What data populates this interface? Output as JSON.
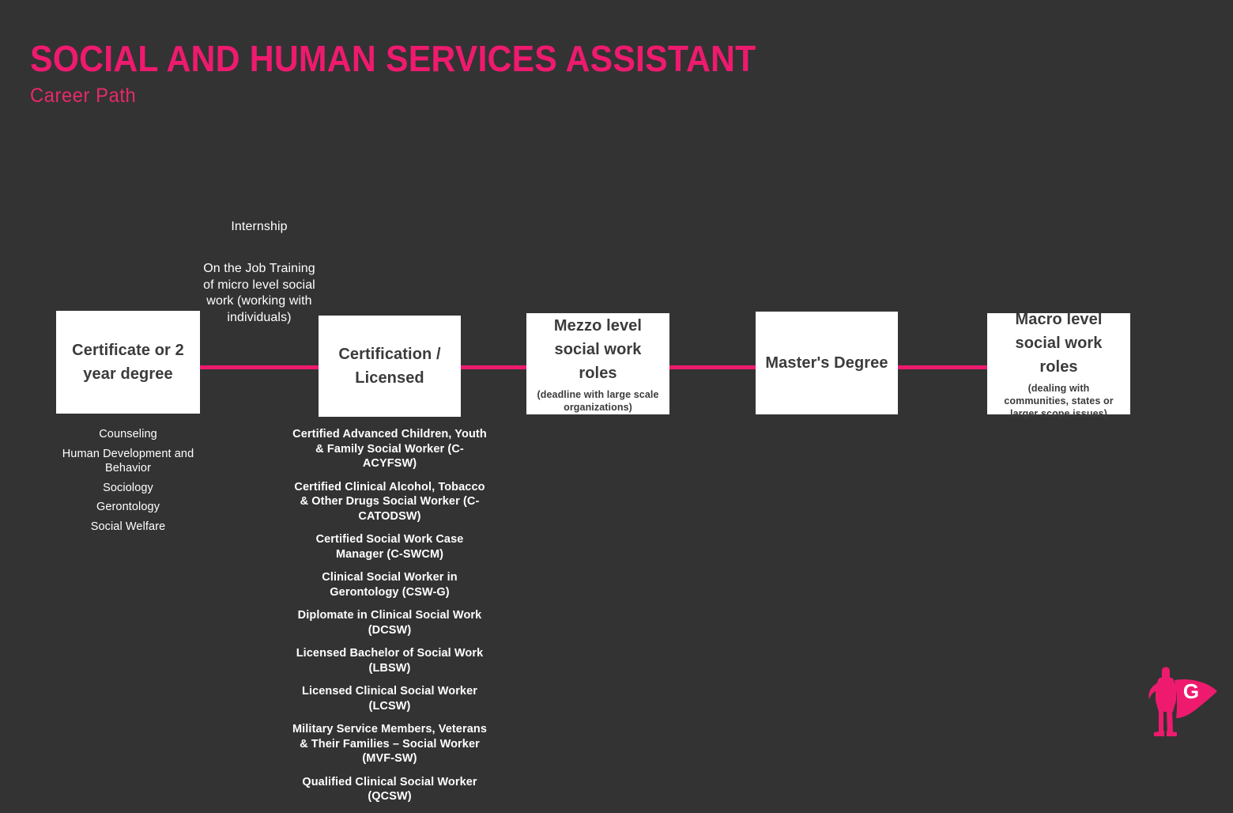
{
  "header": {
    "title": "SOCIAL AND HUMAN SERVICES ASSISTANT",
    "subtitle": "Career Path"
  },
  "colors": {
    "background": "#333333",
    "accent_pink": "#EE1A6E",
    "node_background": "#FFFFFF",
    "node_text": "#3B3B3B",
    "body_text": "#FFFFFF"
  },
  "notes": [
    {
      "id": "internship",
      "text": "Internship"
    },
    {
      "id": "on-the-job-training",
      "text": "On the Job Training of micro level social work (working with individuals)"
    }
  ],
  "nodes": [
    {
      "id": "certificate-or-2-year-degree",
      "title": "Certificate or 2 year degree",
      "subtitle": ""
    },
    {
      "id": "certification-licensed",
      "title": "Certification / Licensed",
      "subtitle": ""
    },
    {
      "id": "mezzo-level-social-work-roles",
      "title": "Mezzo level social work roles",
      "subtitle": "(deadline with large scale organizations)"
    },
    {
      "id": "masters-degree",
      "title": "Master's Degree",
      "subtitle": ""
    },
    {
      "id": "macro-level-social-work-roles",
      "title": "Macro level social work roles",
      "subtitle": "(dealing with communities, states or larger scope issues)"
    }
  ],
  "degree_fields": [
    "Counseling",
    "Human Development and Behavior",
    "Sociology",
    "Gerontology",
    "Social Welfare"
  ],
  "certifications": [
    "Certified Advanced Children, Youth & Family Social Worker (C-ACYFSW)",
    "Certified Clinical Alcohol, Tobacco & Other Drugs Social Worker (C-CATODSW)",
    "Certified Social Work Case Manager (C-SWCM)",
    "Clinical Social Worker in Gerontology (CSW-G)",
    "Diplomate in Clinical Social Work (DCSW)",
    "Licensed Bachelor of Social Work (LBSW)",
    "Licensed Clinical Social Worker (LCSW)",
    "Military Service Members, Veterans & Their Families – Social Worker (MVF-SW)",
    "Qualified Clinical Social Worker (QCSW)"
  ],
  "logo": {
    "letter": "G",
    "description": "superhero-with-cape-logo"
  }
}
